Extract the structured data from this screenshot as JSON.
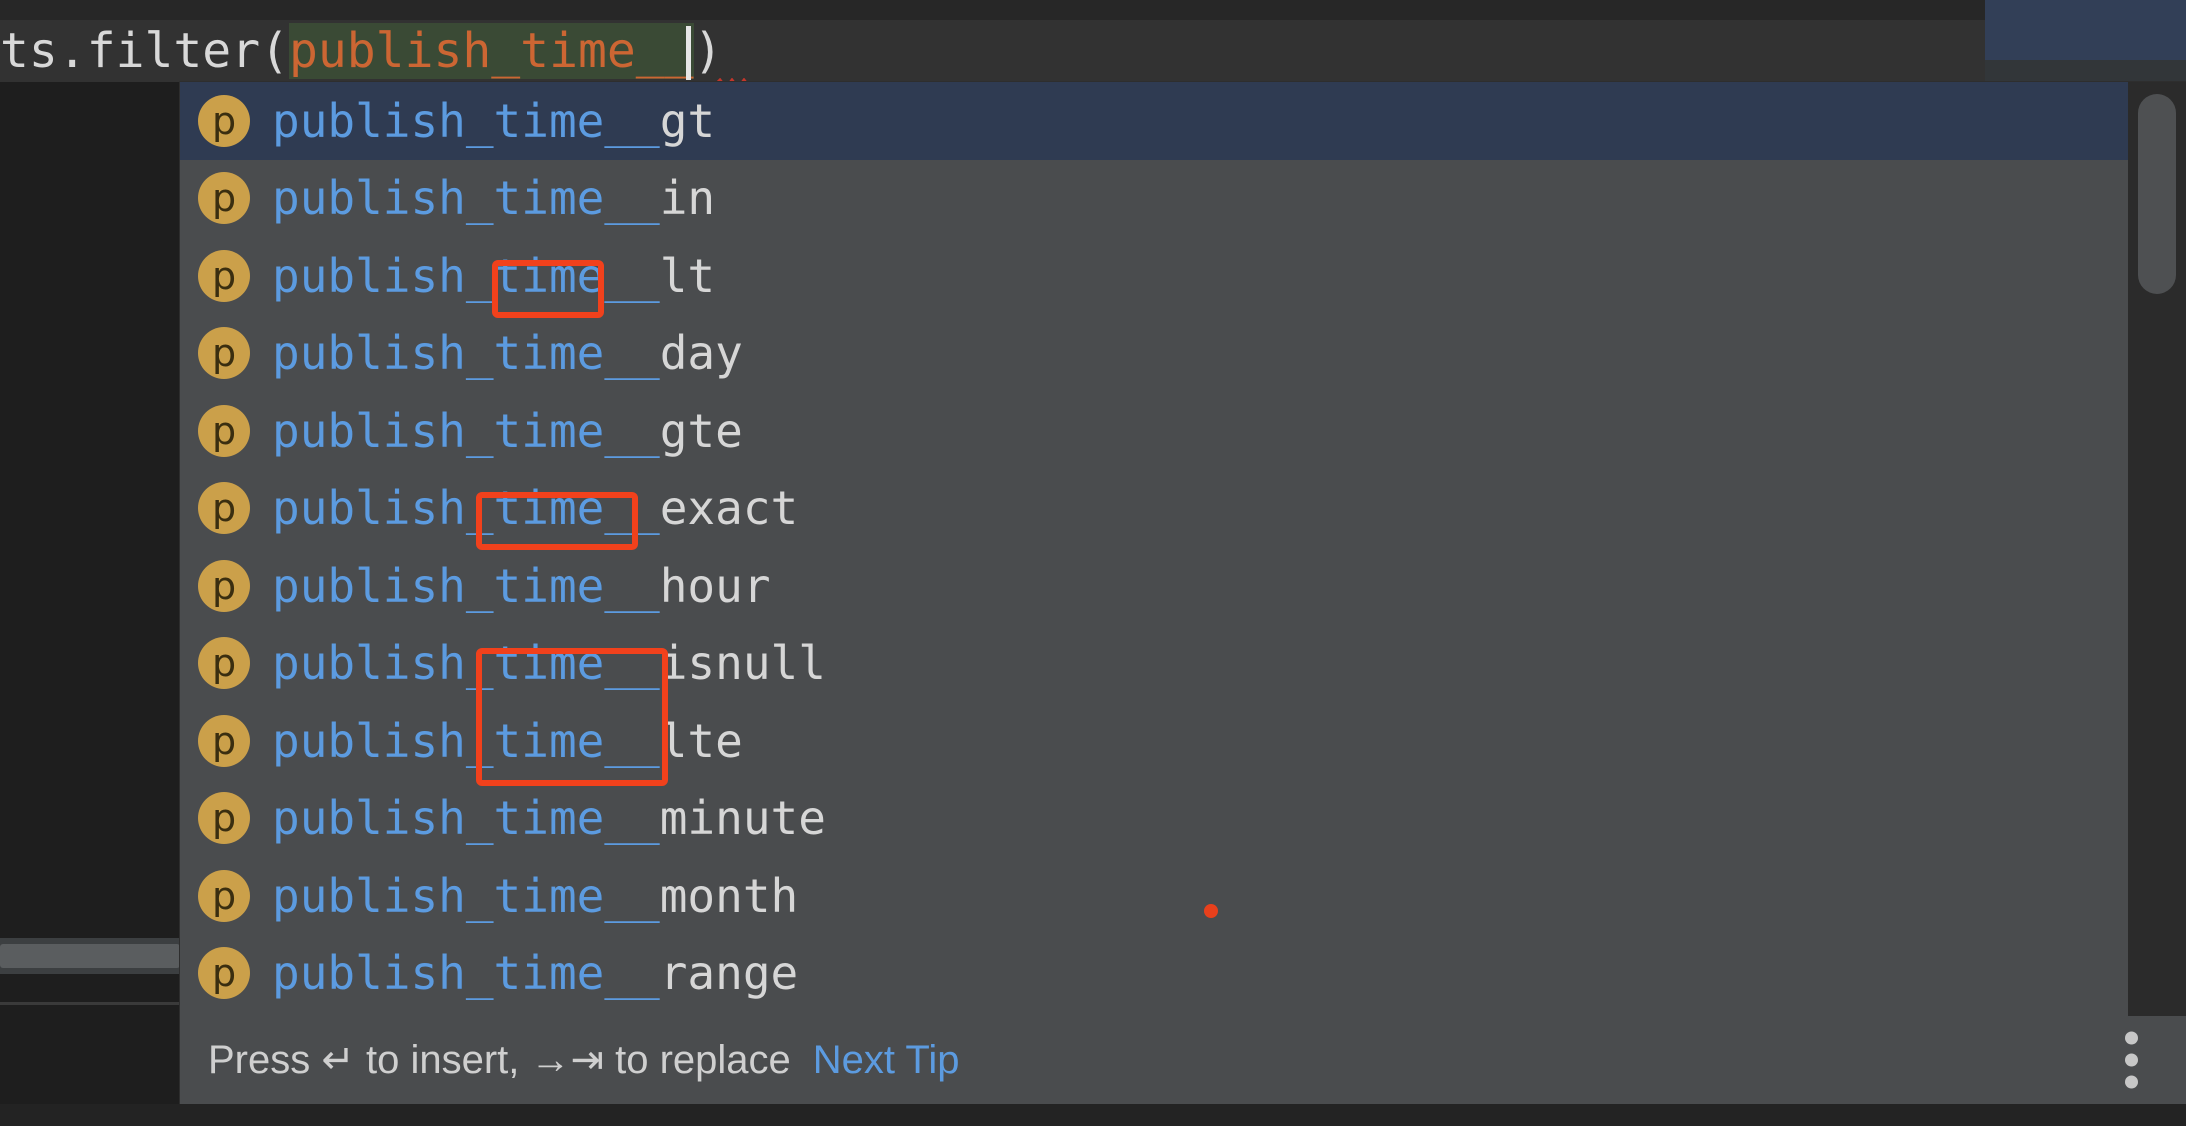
{
  "editor": {
    "code_prefix": "ts.filter(",
    "code_argument": "publish_time__",
    "code_suffix": ")",
    "caret_visible": true
  },
  "completion_popup": {
    "matched_prefix": "publish_time__",
    "items": [
      {
        "icon": "p",
        "prefix": "publish_time__",
        "suffix": "gt",
        "selected": true,
        "boxed": false
      },
      {
        "icon": "p",
        "prefix": "publish_time__",
        "suffix": "in",
        "selected": false,
        "boxed": false
      },
      {
        "icon": "p",
        "prefix": "publish_time__",
        "suffix": "lt",
        "selected": false,
        "boxed": false
      },
      {
        "icon": "p",
        "prefix": "publish_time__",
        "suffix": "day",
        "selected": false,
        "boxed": true
      },
      {
        "icon": "p",
        "prefix": "publish_time__",
        "suffix": "gte",
        "selected": false,
        "boxed": false
      },
      {
        "icon": "p",
        "prefix": "publish_time__",
        "suffix": "exact",
        "selected": false,
        "boxed": false
      },
      {
        "icon": "p",
        "prefix": "publish_time__",
        "suffix": "hour",
        "selected": false,
        "boxed": true
      },
      {
        "icon": "p",
        "prefix": "publish_time__",
        "suffix": "isnull",
        "selected": false,
        "boxed": false
      },
      {
        "icon": "p",
        "prefix": "publish_time__",
        "suffix": "lte",
        "selected": false,
        "boxed": false
      },
      {
        "icon": "p",
        "prefix": "publish_time__",
        "suffix": "minute",
        "selected": false,
        "boxed": true
      },
      {
        "icon": "p",
        "prefix": "publish_time__",
        "suffix": "month",
        "selected": false,
        "boxed": true
      },
      {
        "icon": "p",
        "prefix": "publish_time__",
        "suffix": "range",
        "selected": false,
        "boxed": false
      }
    ],
    "scrollbar": {
      "visible": true
    }
  },
  "status_bar": {
    "hint": "Press ↵ to insert, →⇥ to replace",
    "link_label": "Next Tip",
    "more_icon": "kebab-menu-icon"
  },
  "colors": {
    "popup_background": "#4A4C4E",
    "selected_row": "#2F3B52",
    "match_text": "#5C9BE0",
    "rest_text": "#D6D6D6",
    "icon_badge": "#CBA04A",
    "annotation_red": "#F1411C",
    "code_argument": "#CC6633",
    "code_argument_bg": "#3A4A35",
    "link": "#5C9BE0"
  }
}
